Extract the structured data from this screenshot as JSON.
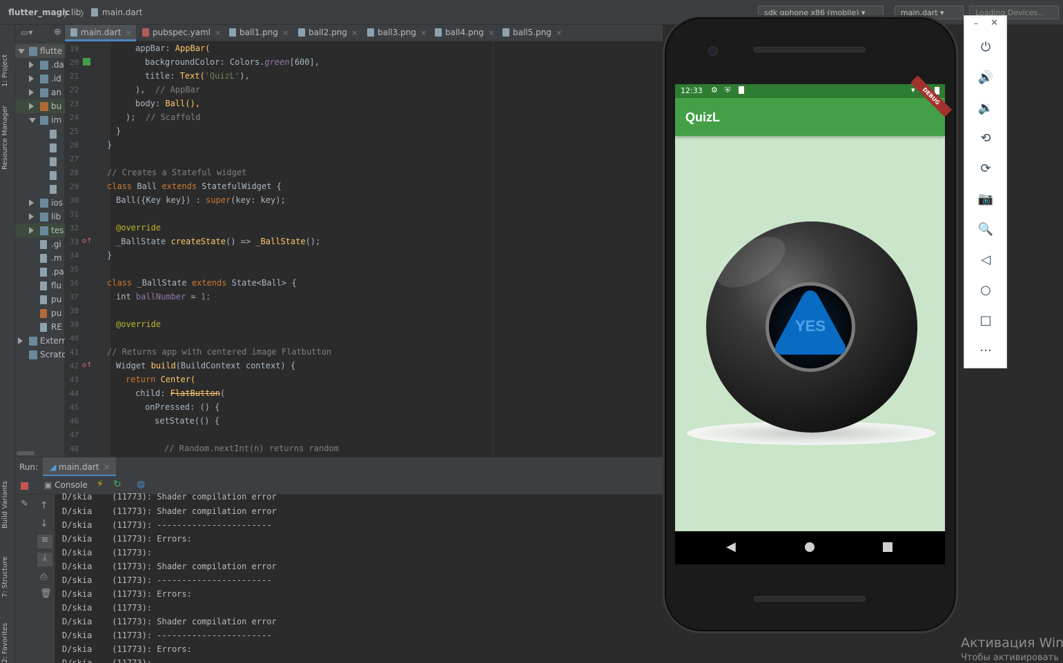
{
  "breadcrumb": {
    "project": "flutter_magic",
    "folder": "lib",
    "file": "main.dart"
  },
  "toolbar": {
    "device": "sdk gphone x86 (mobile)",
    "run_config": "main.dart",
    "devices_combo": "Loading Devices..."
  },
  "side_tabs": {
    "project": "1: Project",
    "resource_manager": "Resource Manager",
    "build_variants": "Build Variants",
    "structure": "7: Structure",
    "favorites": "2: Favorites"
  },
  "tabs": [
    {
      "label": "main.dart"
    },
    {
      "label": "pubspec.yaml"
    },
    {
      "label": "ball1.png"
    },
    {
      "label": "ball2.png"
    },
    {
      "label": "ball3.png"
    },
    {
      "label": "ball4.png"
    },
    {
      "label": "ball5.png"
    }
  ],
  "tree": [
    {
      "label": "flutte"
    },
    {
      "label": ".da"
    },
    {
      "label": ".id"
    },
    {
      "label": "an"
    },
    {
      "label": "bu"
    },
    {
      "label": "im"
    },
    {
      "label": ""
    },
    {
      "label": ""
    },
    {
      "label": ""
    },
    {
      "label": ""
    },
    {
      "label": ""
    },
    {
      "label": "ios"
    },
    {
      "label": "lib"
    },
    {
      "label": "tes"
    },
    {
      "label": ".gi"
    },
    {
      "label": ".m"
    },
    {
      "label": ".pa"
    },
    {
      "label": "flu"
    },
    {
      "label": "pu"
    },
    {
      "label": "pu"
    },
    {
      "label": "RE"
    },
    {
      "label": "Extern"
    },
    {
      "label": "Scrato"
    }
  ],
  "code_lines": [
    {
      "n": "19"
    },
    {
      "n": "20"
    },
    {
      "n": "21"
    },
    {
      "n": "22"
    },
    {
      "n": "23"
    },
    {
      "n": "24"
    },
    {
      "n": "25"
    },
    {
      "n": "26"
    },
    {
      "n": "27"
    },
    {
      "n": "28"
    },
    {
      "n": "29"
    },
    {
      "n": "30"
    },
    {
      "n": "31"
    },
    {
      "n": "32"
    },
    {
      "n": "33"
    },
    {
      "n": "34"
    },
    {
      "n": "35"
    },
    {
      "n": "36"
    },
    {
      "n": "37"
    },
    {
      "n": "38"
    },
    {
      "n": "39"
    },
    {
      "n": "40"
    },
    {
      "n": "41"
    },
    {
      "n": "42"
    },
    {
      "n": "43"
    },
    {
      "n": "44"
    },
    {
      "n": "45"
    },
    {
      "n": "46"
    },
    {
      "n": "47"
    },
    {
      "n": "48"
    }
  ],
  "code": {
    "l19a": "appBar: ",
    "l19b": "AppBar(",
    "l20a": "backgroundColor: Colors.",
    "l20b": "green",
    "l20c": "[600],",
    "l21a": "title: ",
    "l21b": "Text(",
    "l21c": "'QuizL'",
    "l21d": "),",
    "l22a": "),",
    "l22b": "// AppBar",
    "l23a": "body: ",
    "l23b": "Ball(),",
    "l24a": ");",
    "l24b": "// Scaffold",
    "l25": "}",
    "l26": "}",
    "l28": "// Creates a Stateful widget",
    "l29a": "class ",
    "l29b": "Ball ",
    "l29c": "extends ",
    "l29d": "StatefulWidget {",
    "l30a": "Ball({Key key}) : ",
    "l30b": "super",
    "l30c": "(key: key);",
    "l32": "@override",
    "l33a": "_BallState ",
    "l33b": "createState",
    "l33c": "() => ",
    "l33d": "_BallState",
    "l33e": "();",
    "l34": "}",
    "l36a": "class ",
    "l36b": "_BallState ",
    "l36c": "extends ",
    "l36d": "State<Ball> {",
    "l37a": "int ",
    "l37b": "ballNumber",
    "l37c": " = ",
    "l37d": "1",
    "l37e": ";",
    "l39": "@override",
    "l41": "// Returns app with centered image Flatbutton",
    "l42a": "Widget ",
    "l42b": "build",
    "l42c": "(BuildContext context) {",
    "l43a": "return ",
    "l43b": "Center(",
    "l44a": "child: ",
    "l44b": "FlatButton",
    "l44c": "(",
    "l45": "onPressed: () {",
    "l46a": "setState",
    "l46b": "(() {",
    "l48": "// Random.nextInt(n) returns random"
  },
  "run": {
    "label": "Run:",
    "config_tab": "main.dart",
    "console_tab": "Console"
  },
  "console_lines": [
    "D/skia    (11773): Shader compilation error",
    "D/skia    (11773): -----------------------",
    "D/skia    (11773): Errors:",
    "D/skia    (11773):",
    "D/skia    (11773): Shader compilation error",
    "D/skia    (11773): -----------------------",
    "D/skia    (11773): Errors:",
    "D/skia    (11773):",
    "D/skia    (11773): Shader compilation error",
    "D/skia    (11773): -----------------------",
    "D/skia    (11773): Errors:",
    "D/skia    (11773):"
  ],
  "phone": {
    "time": "12:33",
    "app_title": "QuizL",
    "debug_banner": "DEBUG",
    "ball_text": "YES",
    "colors": {
      "app_bar": "#43a047",
      "background": "#cae5c9",
      "triangle": "#0a6bc2"
    }
  },
  "emulator_panel": {
    "buttons": [
      "power-icon",
      "volume-up-icon",
      "volume-down-icon",
      "rotate-left-icon",
      "rotate-right-icon",
      "camera-icon",
      "zoom-icon",
      "back-icon",
      "home-icon",
      "overview-icon",
      "more-icon"
    ]
  },
  "watermark": {
    "line1": "Активация Wind",
    "line2": "Чтобы активировать"
  }
}
